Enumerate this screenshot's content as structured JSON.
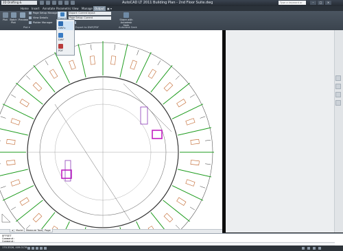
{
  "titlebar": {
    "workspace": "2D Drafting & Annotation",
    "app_title": "AutoCAD LT 2011    Building Plan - 2nd Floor Suite.dwg",
    "search_placeholder": "Type a keyword or phrase"
  },
  "tabs": [
    "Home",
    "Insert",
    "Annotate",
    "Parametric",
    "View",
    "Manage",
    "Output",
    "▣ ▾"
  ],
  "active_tab": "Output",
  "ribbon": {
    "plot_panel": {
      "plot_label": "Plot",
      "batch_plot_label": "Batch Plot",
      "preview_label": "Preview",
      "page_setup_manager": "Page Setup Manager",
      "view_details": "View Details",
      "plotter_manager": "Plotter Manager",
      "panel_title": "Plot ▾"
    },
    "export_panel": {
      "export_label": "Export",
      "export_field": "Export: Current layout",
      "page_setup_field": "Page Setup: Current",
      "panel_title": "Export to DWF/PDF"
    },
    "seek_panel": {
      "share_label": "Share with Autodesk Seek",
      "panel_title": "Autodesk Seek"
    }
  },
  "export_menu": {
    "items": [
      "DWFx",
      "DWF",
      "PDF"
    ],
    "selected": "DWFx"
  },
  "layout_tabs": [
    "Model",
    "Measure Tools",
    "Page"
  ],
  "active_layout": "Model",
  "command": {
    "history": [
      "OFFSET",
      "Command:",
      "Command:"
    ],
    "input": ""
  },
  "statusbar": {
    "coords": "170.3326, 409.0176"
  },
  "colors": {
    "selected_room_magenta": "#c21dc2",
    "room_green": "#1c9b1c",
    "ribbon_bg": "#434c57",
    "canvas_bg": "#ffffff"
  }
}
